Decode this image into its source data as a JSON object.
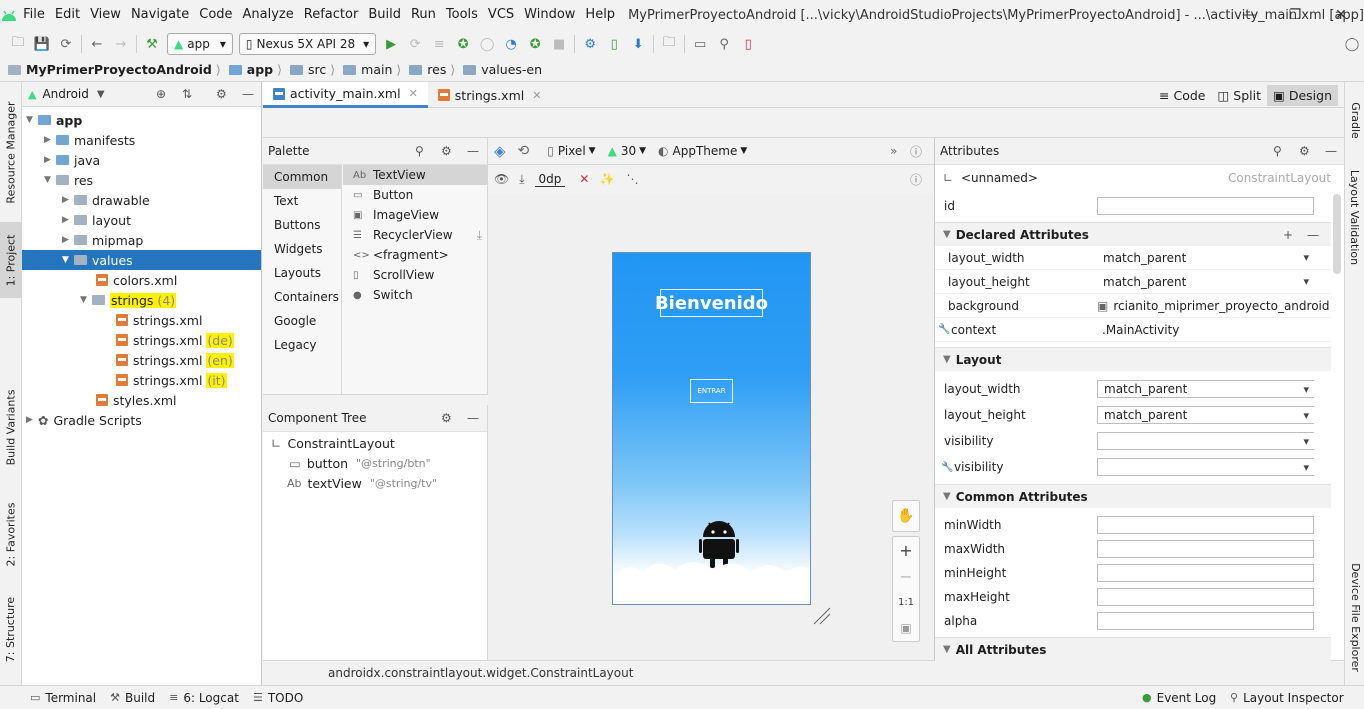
{
  "menu": [
    "File",
    "Edit",
    "View",
    "Navigate",
    "Code",
    "Analyze",
    "Refactor",
    "Build",
    "Run",
    "Tools",
    "VCS",
    "Window",
    "Help"
  ],
  "window_title": "MyPrimerProyectoAndroid [...\\vicky\\AndroidStudioProjects\\MyPrimerProyectoAndroid] - ...\\activity_main.xml [app]",
  "toolbar": {
    "module": "app",
    "device": "Nexus 5X API 28"
  },
  "breadcrumb": [
    "MyPrimerProyectoAndroid",
    "app",
    "src",
    "main",
    "res",
    "values-en"
  ],
  "left_tabs": [
    "Resource Manager",
    "1: Project",
    "Build Variants",
    "2: Favorites",
    "7: Structure"
  ],
  "right_tabs": [
    "Gradle",
    "Layout Validation",
    "Device File Explorer"
  ],
  "project": {
    "view": "Android",
    "tree": [
      {
        "label": "app"
      },
      {
        "label": "manifests"
      },
      {
        "label": "java"
      },
      {
        "label": "res"
      },
      {
        "label": "drawable"
      },
      {
        "label": "layout"
      },
      {
        "label": "mipmap"
      },
      {
        "label": "values"
      },
      {
        "label": "colors.xml"
      },
      {
        "label": "strings",
        "count": "(4)"
      },
      {
        "label": "strings.xml"
      },
      {
        "label": "strings.xml",
        "qual": "(de)"
      },
      {
        "label": "strings.xml",
        "qual": "(en)"
      },
      {
        "label": "strings.xml",
        "qual": "(it)"
      },
      {
        "label": "styles.xml"
      },
      {
        "label": "Gradle Scripts"
      }
    ]
  },
  "editor_tabs": [
    "activity_main.xml",
    "strings.xml"
  ],
  "modes": [
    "Code",
    "Split",
    "Design"
  ],
  "palette": {
    "title": "Palette",
    "categories": [
      "Common",
      "Text",
      "Buttons",
      "Widgets",
      "Layouts",
      "Containers",
      "Google",
      "Legacy"
    ],
    "items": [
      {
        "icon": "Ab",
        "label": "TextView"
      },
      {
        "icon": "▭",
        "label": "Button"
      },
      {
        "icon": "▣",
        "label": "ImageView"
      },
      {
        "icon": "☰",
        "label": "RecyclerView"
      },
      {
        "icon": "<>",
        "label": "<fragment>"
      },
      {
        "icon": "▯",
        "label": "ScrollView"
      },
      {
        "icon": "●",
        "label": "Switch"
      }
    ]
  },
  "component_tree": {
    "title": "Component Tree",
    "root": "ConstraintLayout",
    "children": [
      {
        "icon": "▭",
        "name": "button",
        "value": "\"@string/btn\""
      },
      {
        "icon": "Ab",
        "name": "textView",
        "value": "\"@string/tv\""
      }
    ]
  },
  "design_toolbar": {
    "device": "Pixel",
    "api": "30",
    "theme": "AppTheme",
    "margin": "0dp"
  },
  "preview": {
    "title": "Bienvenido",
    "button": "ENTRAR"
  },
  "zoom": {
    "ratio": "1:1"
  },
  "attributes": {
    "title": "Attributes",
    "component": "<unnamed>",
    "component_type": "ConstraintLayout",
    "id_label": "id",
    "declared_title": "Declared Attributes",
    "declared": [
      {
        "name": "layout_width",
        "value": "match_parent"
      },
      {
        "name": "layout_height",
        "value": "match_parent"
      },
      {
        "name": "background",
        "value": "rcianito_miprimer_proyecto_android"
      },
      {
        "name": "context",
        "value": ".MainActivity"
      }
    ],
    "layout_title": "Layout",
    "layout": [
      {
        "name": "layout_width",
        "value": "match_parent"
      },
      {
        "name": "layout_height",
        "value": "match_parent"
      },
      {
        "name": "visibility",
        "value": ""
      },
      {
        "name": "visibility",
        "value": ""
      }
    ],
    "common_title": "Common Attributes",
    "common": [
      {
        "name": "minWidth"
      },
      {
        "name": "maxWidth"
      },
      {
        "name": "minHeight"
      },
      {
        "name": "maxHeight"
      },
      {
        "name": "alpha"
      }
    ],
    "all_title": "All Attributes"
  },
  "status_path": "androidx.constraintlayout.widget.ConstraintLayout",
  "bottom_tabs": {
    "terminal": "Terminal",
    "build": "Build",
    "logcat": "6: Logcat",
    "todo": "TODO",
    "eventlog": "Event Log",
    "inspector": "Layout Inspector"
  },
  "colors": {
    "accent": "#4083c9",
    "selection": "#2675bf",
    "highlight": "#fff200",
    "android": "#3ddc84"
  }
}
